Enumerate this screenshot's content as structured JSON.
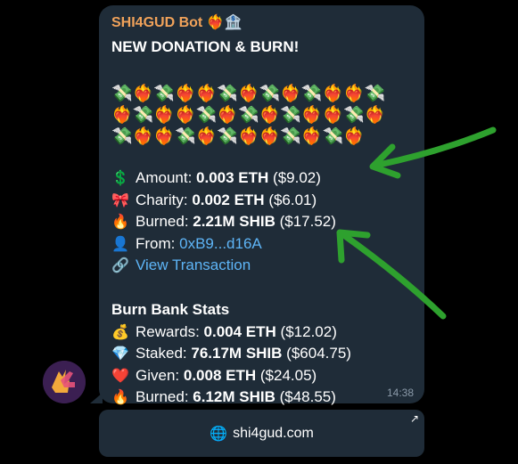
{
  "message": {
    "sender": "SHI4GUD Bot ❤️‍🔥🏦",
    "title": "NEW DONATION & BURN!",
    "emoji_rows": [
      "💸❤️‍🔥💸❤️‍🔥❤️‍🔥💸❤️‍🔥💸❤️‍🔥💸❤️‍🔥❤️‍🔥💸",
      "❤️‍🔥💸❤️‍🔥❤️‍🔥💸❤️‍🔥💸❤️‍🔥💸❤️‍🔥❤️‍🔥💸❤️‍🔥",
      "💸❤️‍🔥❤️‍🔥💸❤️‍🔥💸❤️‍🔥❤️‍🔥💸❤️‍🔥💸❤️‍🔥"
    ],
    "donation": {
      "amount_label": "Amount:",
      "amount_value": "0.003 ETH",
      "amount_usd": "($9.02)",
      "charity_label": "Charity:",
      "charity_value": "0.002 ETH",
      "charity_usd": "($6.01)",
      "burned_label": "Burned:",
      "burned_value": "2.21M SHIB",
      "burned_usd": "($17.52)",
      "from_label": "From:",
      "from_value": "0xB9...d16A",
      "view_tx": "View Transaction"
    },
    "stats": {
      "title": "Burn Bank Stats",
      "rewards_label": "Rewards:",
      "rewards_value": "0.004 ETH",
      "rewards_usd": "($12.02)",
      "staked_label": "Staked:",
      "staked_value": "76.17M SHIB",
      "staked_usd": "($604.75)",
      "given_label": "Given:",
      "given_value": "0.008 ETH",
      "given_usd": "($24.05)",
      "burned_label": "Burned:",
      "burned_value": "6.12M SHIB",
      "burned_usd": "($48.55)"
    },
    "time": "14:38"
  },
  "button": {
    "label": "shi4gud.com"
  },
  "icons": {
    "amount": "dollar-sign-icon",
    "charity": "ribbon-icon",
    "burned": "fire-icon",
    "from": "user-icon",
    "view": "link-icon",
    "rewards": "money-bag-icon",
    "staked": "gem-icon",
    "given": "heart-icon",
    "globe": "globe-icon"
  },
  "colors": {
    "bubble": "#1f2c38",
    "sender": "#f0a25a",
    "link": "#5eb5f7",
    "arrow": "#2ea12e"
  }
}
